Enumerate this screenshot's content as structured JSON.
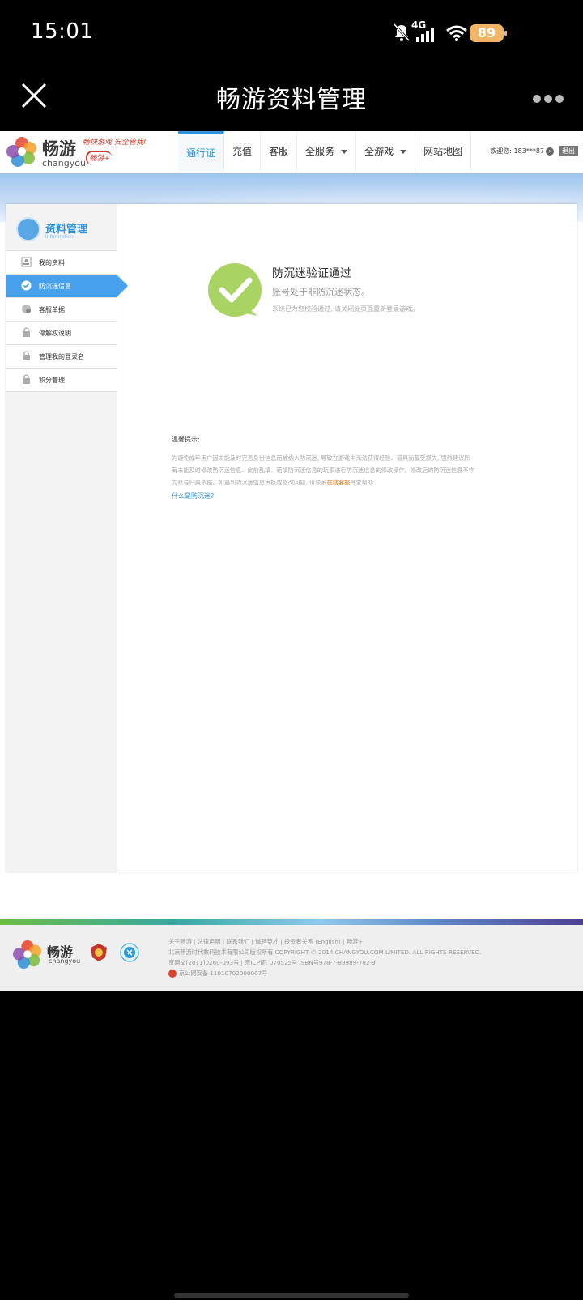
{
  "status_bar": {
    "time": "15:01",
    "network": "4G",
    "battery": "89"
  },
  "title_bar": {
    "title": "畅游资料管理"
  },
  "site_header": {
    "logo_cn": "畅游",
    "logo_en": "changyou",
    "slogan": "畅快游戏 安全管我!",
    "plus_badge": "畅游+",
    "nav": [
      "通行证",
      "充值",
      "客服",
      "全服务",
      "全游戏",
      "网站地图"
    ],
    "welcome": "欢迎您: 183***87",
    "logout": "退出"
  },
  "sidebar": {
    "title": "资料管理",
    "subtitle": "Information",
    "items": [
      "我的资料",
      "防沉迷信息",
      "客服单据",
      "停解权说明",
      "管理我的登录名",
      "积分管理"
    ]
  },
  "result": {
    "title": "防沉迷验证通过",
    "subtitle": "账号处于非防沉迷状态。",
    "note": "系统已为您校验通过, 请关闭此页面重新登录游戏。"
  },
  "tips": {
    "heading": "温馨提示:",
    "line1": "为避免成年用户因未能及时完善身份信息而被纳入防沉迷, 导致在游戏中无法获得经验、道具而蒙受损失, 强烈建议所",
    "line2": "有未能及时修改防沉迷信息、此前乱填、错填防沉迷信息的玩家进行防沉迷信息的修改操作。修改后的防沉迷信息不作",
    "line3_a": "为账号归属依据。如遇到防沉迷信息审核或修改问题, 请联系",
    "line3_link": "在线客服",
    "line3_b": "寻求帮助",
    "question": "什么是防沉迷?"
  },
  "footer": {
    "logo_cn": "畅游",
    "logo_en": "changyou",
    "links": "关于畅游 | 法律声明 | 联系我们 | 诚聘英才 | 投资者关系 (English) | 畅游+",
    "copyright": "北京畅游时代数码技术有限公司版权所有 COPYRIGHT © 2014 CHANGYOU.COM LIMITED. ALL RIGHTS RESERVED.",
    "license": "京网文[2011]0260-093号 | 京ICP证: 070525号 ISBN号978-7-89989-782-9",
    "police": "京公网安备 11010702000007号"
  }
}
